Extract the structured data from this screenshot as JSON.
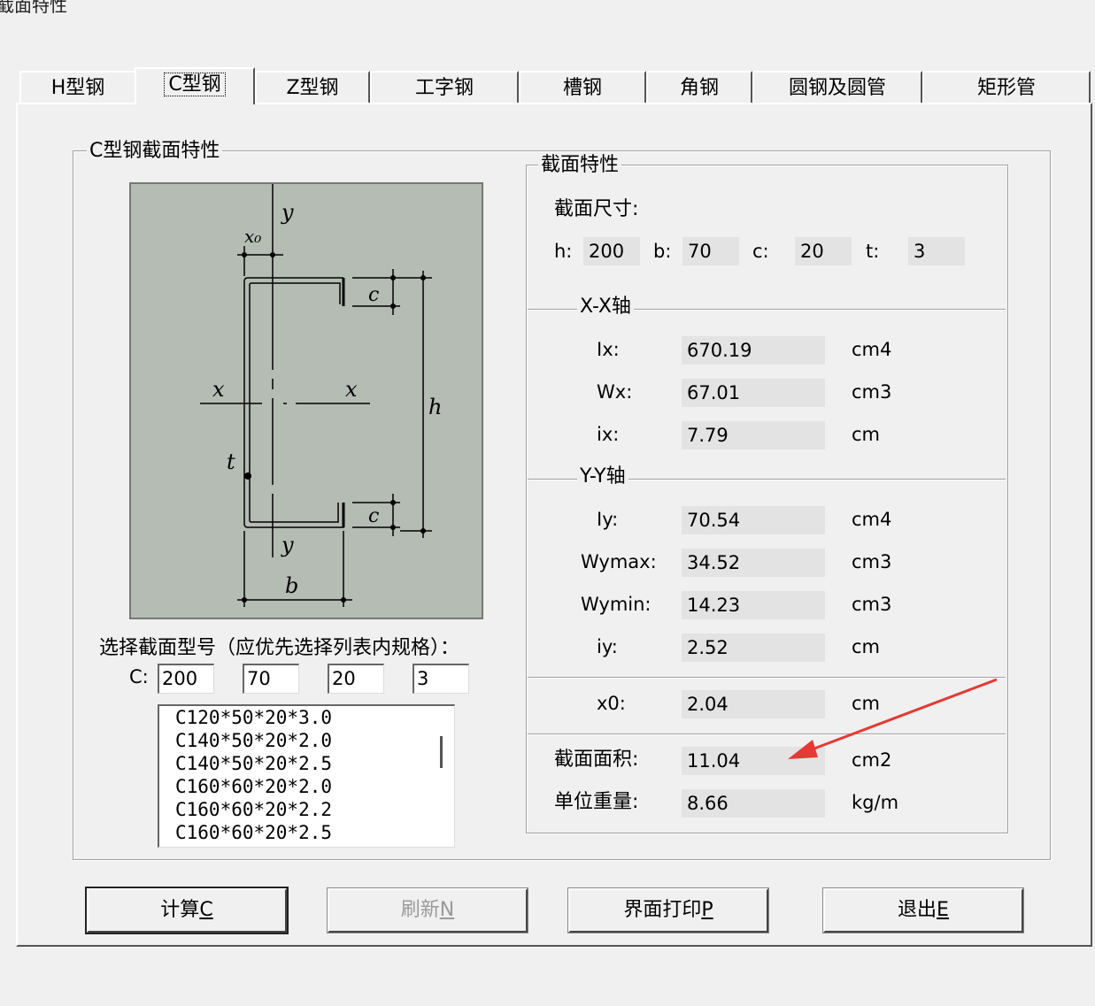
{
  "window": {
    "title": "截面特性"
  },
  "tabs": [
    {
      "label": "H型钢"
    },
    {
      "label": "C型钢"
    },
    {
      "label": "Z型钢"
    },
    {
      "label": "工字钢"
    },
    {
      "label": "槽钢"
    },
    {
      "label": "角钢"
    },
    {
      "label": "圆钢及圆管"
    },
    {
      "label": "矩形管"
    }
  ],
  "left_group": {
    "title": "C型钢截面特性",
    "diagram": {
      "x0": "x₀",
      "y_top": "y",
      "y_bottom": "y",
      "x_left": "x",
      "x_right": "x",
      "c_top": "c",
      "c_bottom": "c",
      "h": "h",
      "t": "t",
      "b": "b"
    },
    "select_label": "选择截面型号（应优先选择列表内规格）：",
    "c_label": "C:",
    "inputs": {
      "h": "200",
      "b": "70",
      "c": "20",
      "t": "3"
    },
    "list": [
      "C120*50*20*3.0",
      "C140*50*20*2.0",
      "C140*50*20*2.5",
      "C160*60*20*2.0",
      "C160*60*20*2.2",
      "C160*60*20*2.5"
    ]
  },
  "right_group": {
    "title": "截面特性",
    "dims_label": "截面尺寸:",
    "dims": {
      "h_label": "h:",
      "h": "200",
      "b_label": "b:",
      "b": "70",
      "c_label": "c:",
      "c": "20",
      "t_label": "t:",
      "t": "3"
    },
    "xx_title": "X-X轴",
    "Ix": {
      "label": "Ix:",
      "value": "670.19",
      "unit": "cm4"
    },
    "Wx": {
      "label": "Wx:",
      "value": "67.01",
      "unit": "cm3"
    },
    "ix": {
      "label": "ix:",
      "value": "7.79",
      "unit": "cm"
    },
    "yy_title": "Y-Y轴",
    "Iy": {
      "label": "Iy:",
      "value": "70.54",
      "unit": "cm4"
    },
    "Wymax": {
      "label": "Wymax:",
      "value": "34.52",
      "unit": "cm3"
    },
    "Wymin": {
      "label": "Wymin:",
      "value": "14.23",
      "unit": "cm3"
    },
    "iy": {
      "label": "iy:",
      "value": "2.52",
      "unit": "cm"
    },
    "x0": {
      "label": "x0:",
      "value": "2.04",
      "unit": "cm"
    },
    "area": {
      "label": "截面面积:",
      "value": "11.04",
      "unit": "cm2"
    },
    "weight": {
      "label": "单位重量:",
      "value": "8.66",
      "unit": "kg/m"
    }
  },
  "buttons": {
    "calc": {
      "text": "计算",
      "key": "C"
    },
    "refresh": {
      "text": "刷新",
      "key": "N"
    },
    "print": {
      "text": "界面打印",
      "key": "P"
    },
    "exit": {
      "text": "退出",
      "key": "E"
    }
  },
  "colors": {
    "annotation_arrow": "#e53935",
    "diagram_bg": "#b4bcb4"
  }
}
